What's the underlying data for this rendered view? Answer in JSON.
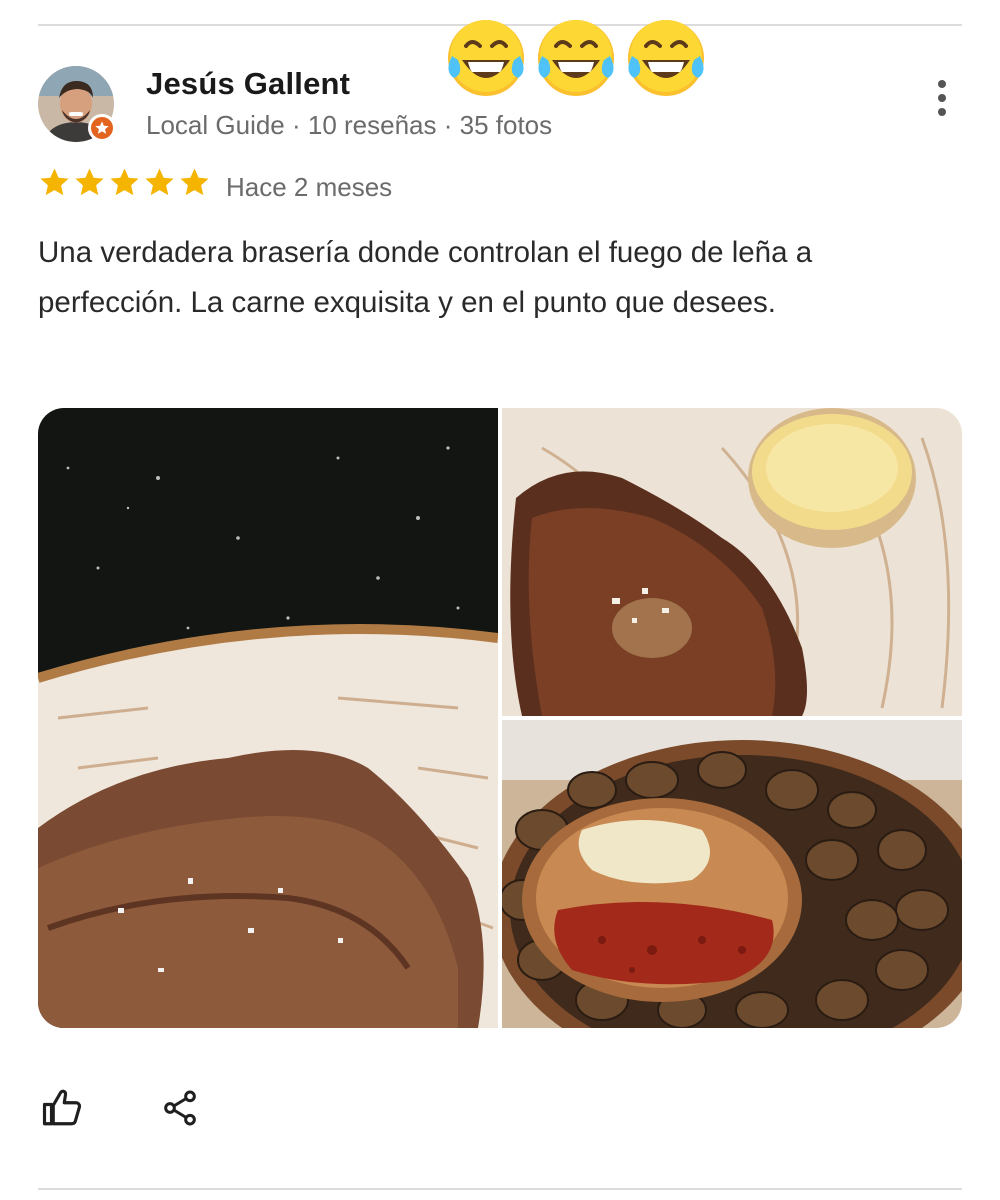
{
  "review": {
    "reviewer_name": "Jesús Gallent",
    "reviewer_meta": "Local Guide · 10 reseñas · 35 fotos",
    "rating": 5,
    "max_rating": 5,
    "date": "Hace 2 meses",
    "text": "Una verdadera brasería donde controlan el fuego de leña a perfección. La carne exquisita y en el punto que desees."
  },
  "overlay": {
    "emojis": [
      "face-with-tears-of-joy",
      "face-with-tears-of-joy",
      "face-with-tears-of-joy"
    ]
  },
  "icons": {
    "badge": "local-guide-star-badge",
    "more": "more-vertical-icon",
    "like": "thumbs-up-icon",
    "share": "share-icon"
  },
  "colors": {
    "star": "#f4b400",
    "badge": "#e2641f",
    "meta_text": "#6b6b6b"
  },
  "photos": [
    {
      "id": "photo-grilled-steak-dark"
    },
    {
      "id": "photo-steak-with-potato"
    },
    {
      "id": "photo-snails-with-sauces"
    }
  ]
}
